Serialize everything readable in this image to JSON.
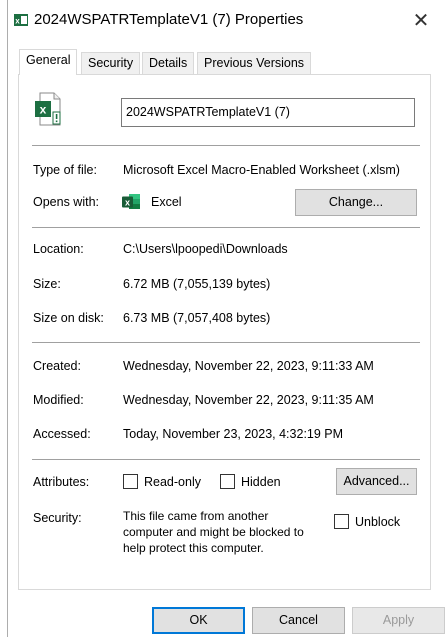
{
  "window": {
    "title": "2024WSPATRTemplateV1 (7) Properties",
    "close_glyph": "✕"
  },
  "tabs": [
    {
      "label": "General",
      "active": true
    },
    {
      "label": "Security",
      "active": false
    },
    {
      "label": "Details",
      "active": false
    },
    {
      "label": "Previous Versions",
      "active": false
    }
  ],
  "general": {
    "file_name": "2024WSPATRTemplateV1 (7)",
    "type_label": "Type of file:",
    "type_value": "Microsoft Excel Macro-Enabled Worksheet (.xlsm)",
    "opens_label": "Opens with:",
    "opens_value": "Excel",
    "change_button": "Change...",
    "location_label": "Location:",
    "location_value": "C:\\Users\\lpoopedi\\Downloads",
    "size_label": "Size:",
    "size_value": "6.72 MB (7,055,139 bytes)",
    "size_on_disk_label": "Size on disk:",
    "size_on_disk_value": "6.73 MB (7,057,408 bytes)",
    "created_label": "Created:",
    "created_value": "Wednesday, November 22, 2023, 9:11:33 AM",
    "modified_label": "Modified:",
    "modified_value": "Wednesday, November 22, 2023, 9:11:35 AM",
    "accessed_label": "Accessed:",
    "accessed_value": "Today, November 23, 2023, 4:32:19 PM",
    "attributes_label": "Attributes:",
    "readonly_label": "Read-only",
    "hidden_label": "Hidden",
    "advanced_button": "Advanced...",
    "security_label": "Security:",
    "security_text_1": "This file came from another",
    "security_text_2": "computer and might be blocked to",
    "security_text_3": "help protect this computer.",
    "unblock_label": "Unblock"
  },
  "footer": {
    "ok": "OK",
    "cancel": "Cancel",
    "apply": "Apply"
  },
  "colors": {
    "excel_green": "#1d6f42",
    "accent_blue": "#0078d7",
    "separator": "#a0a0a0"
  },
  "icons": {
    "title": "excel-file-icon",
    "file": "excel-macro-file-icon",
    "opens_with": "excel-app-icon",
    "close": "close-icon"
  }
}
